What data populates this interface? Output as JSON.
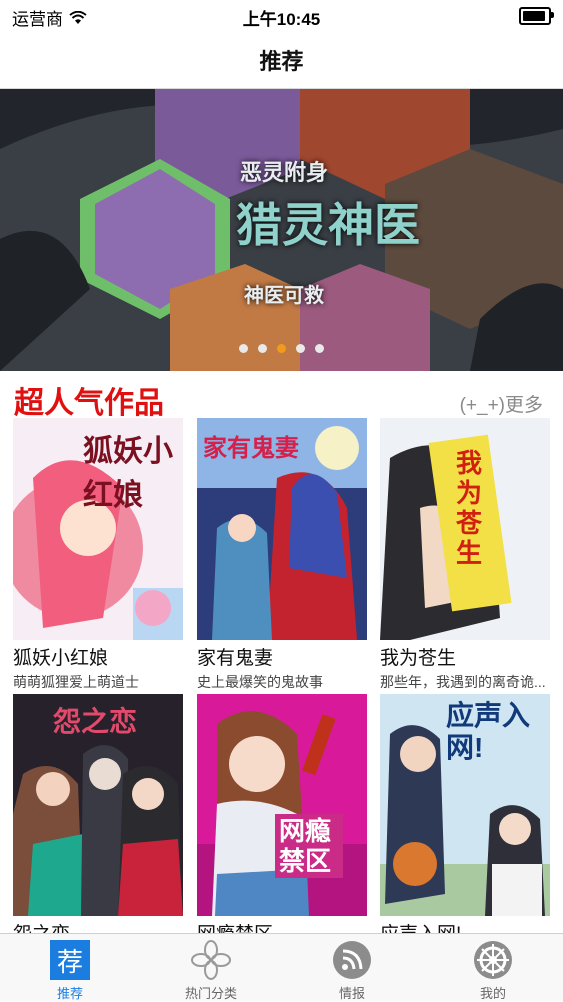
{
  "status": {
    "carrier": "运营商",
    "time": "上午10:45"
  },
  "nav": {
    "title": "推荐"
  },
  "banner": {
    "caption_top": "恶灵附身",
    "caption_main": "猎灵神医",
    "caption_bottom": "神医可救",
    "page_count": 5,
    "active_page": 3
  },
  "section": {
    "title": "超人气作品",
    "more": "(+_+)更多"
  },
  "comics": [
    {
      "title": "狐妖小红娘",
      "desc": "萌萌狐狸爱上萌道士",
      "cover_text": "狐妖小红娘"
    },
    {
      "title": "家有鬼妻",
      "desc": "史上最爆笑的鬼故事",
      "cover_text": "家有鬼妻"
    },
    {
      "title": "我为苍生",
      "desc": "那些年，我遇到的离奇诡...",
      "cover_text": "我为苍生"
    },
    {
      "title": "怨之恋",
      "desc": "",
      "cover_text": "怨之恋"
    },
    {
      "title": "网瘾禁区",
      "desc": "",
      "cover_text": "网瘾禁区"
    },
    {
      "title": "应声入网!",
      "desc": "",
      "cover_text": "应声入网!"
    }
  ],
  "tabs": [
    {
      "label": "推荐",
      "icon": "recommend-icon",
      "glyph": "荐",
      "active": true
    },
    {
      "label": "热门分类",
      "icon": "clover-icon",
      "active": false
    },
    {
      "label": "情报",
      "icon": "rss-icon",
      "active": false
    },
    {
      "label": "我的",
      "icon": "wheel-icon",
      "active": false
    }
  ],
  "colors": {
    "accent": "#1b7de0",
    "section_title": "#e01010",
    "dot_active": "#f29a1b"
  }
}
